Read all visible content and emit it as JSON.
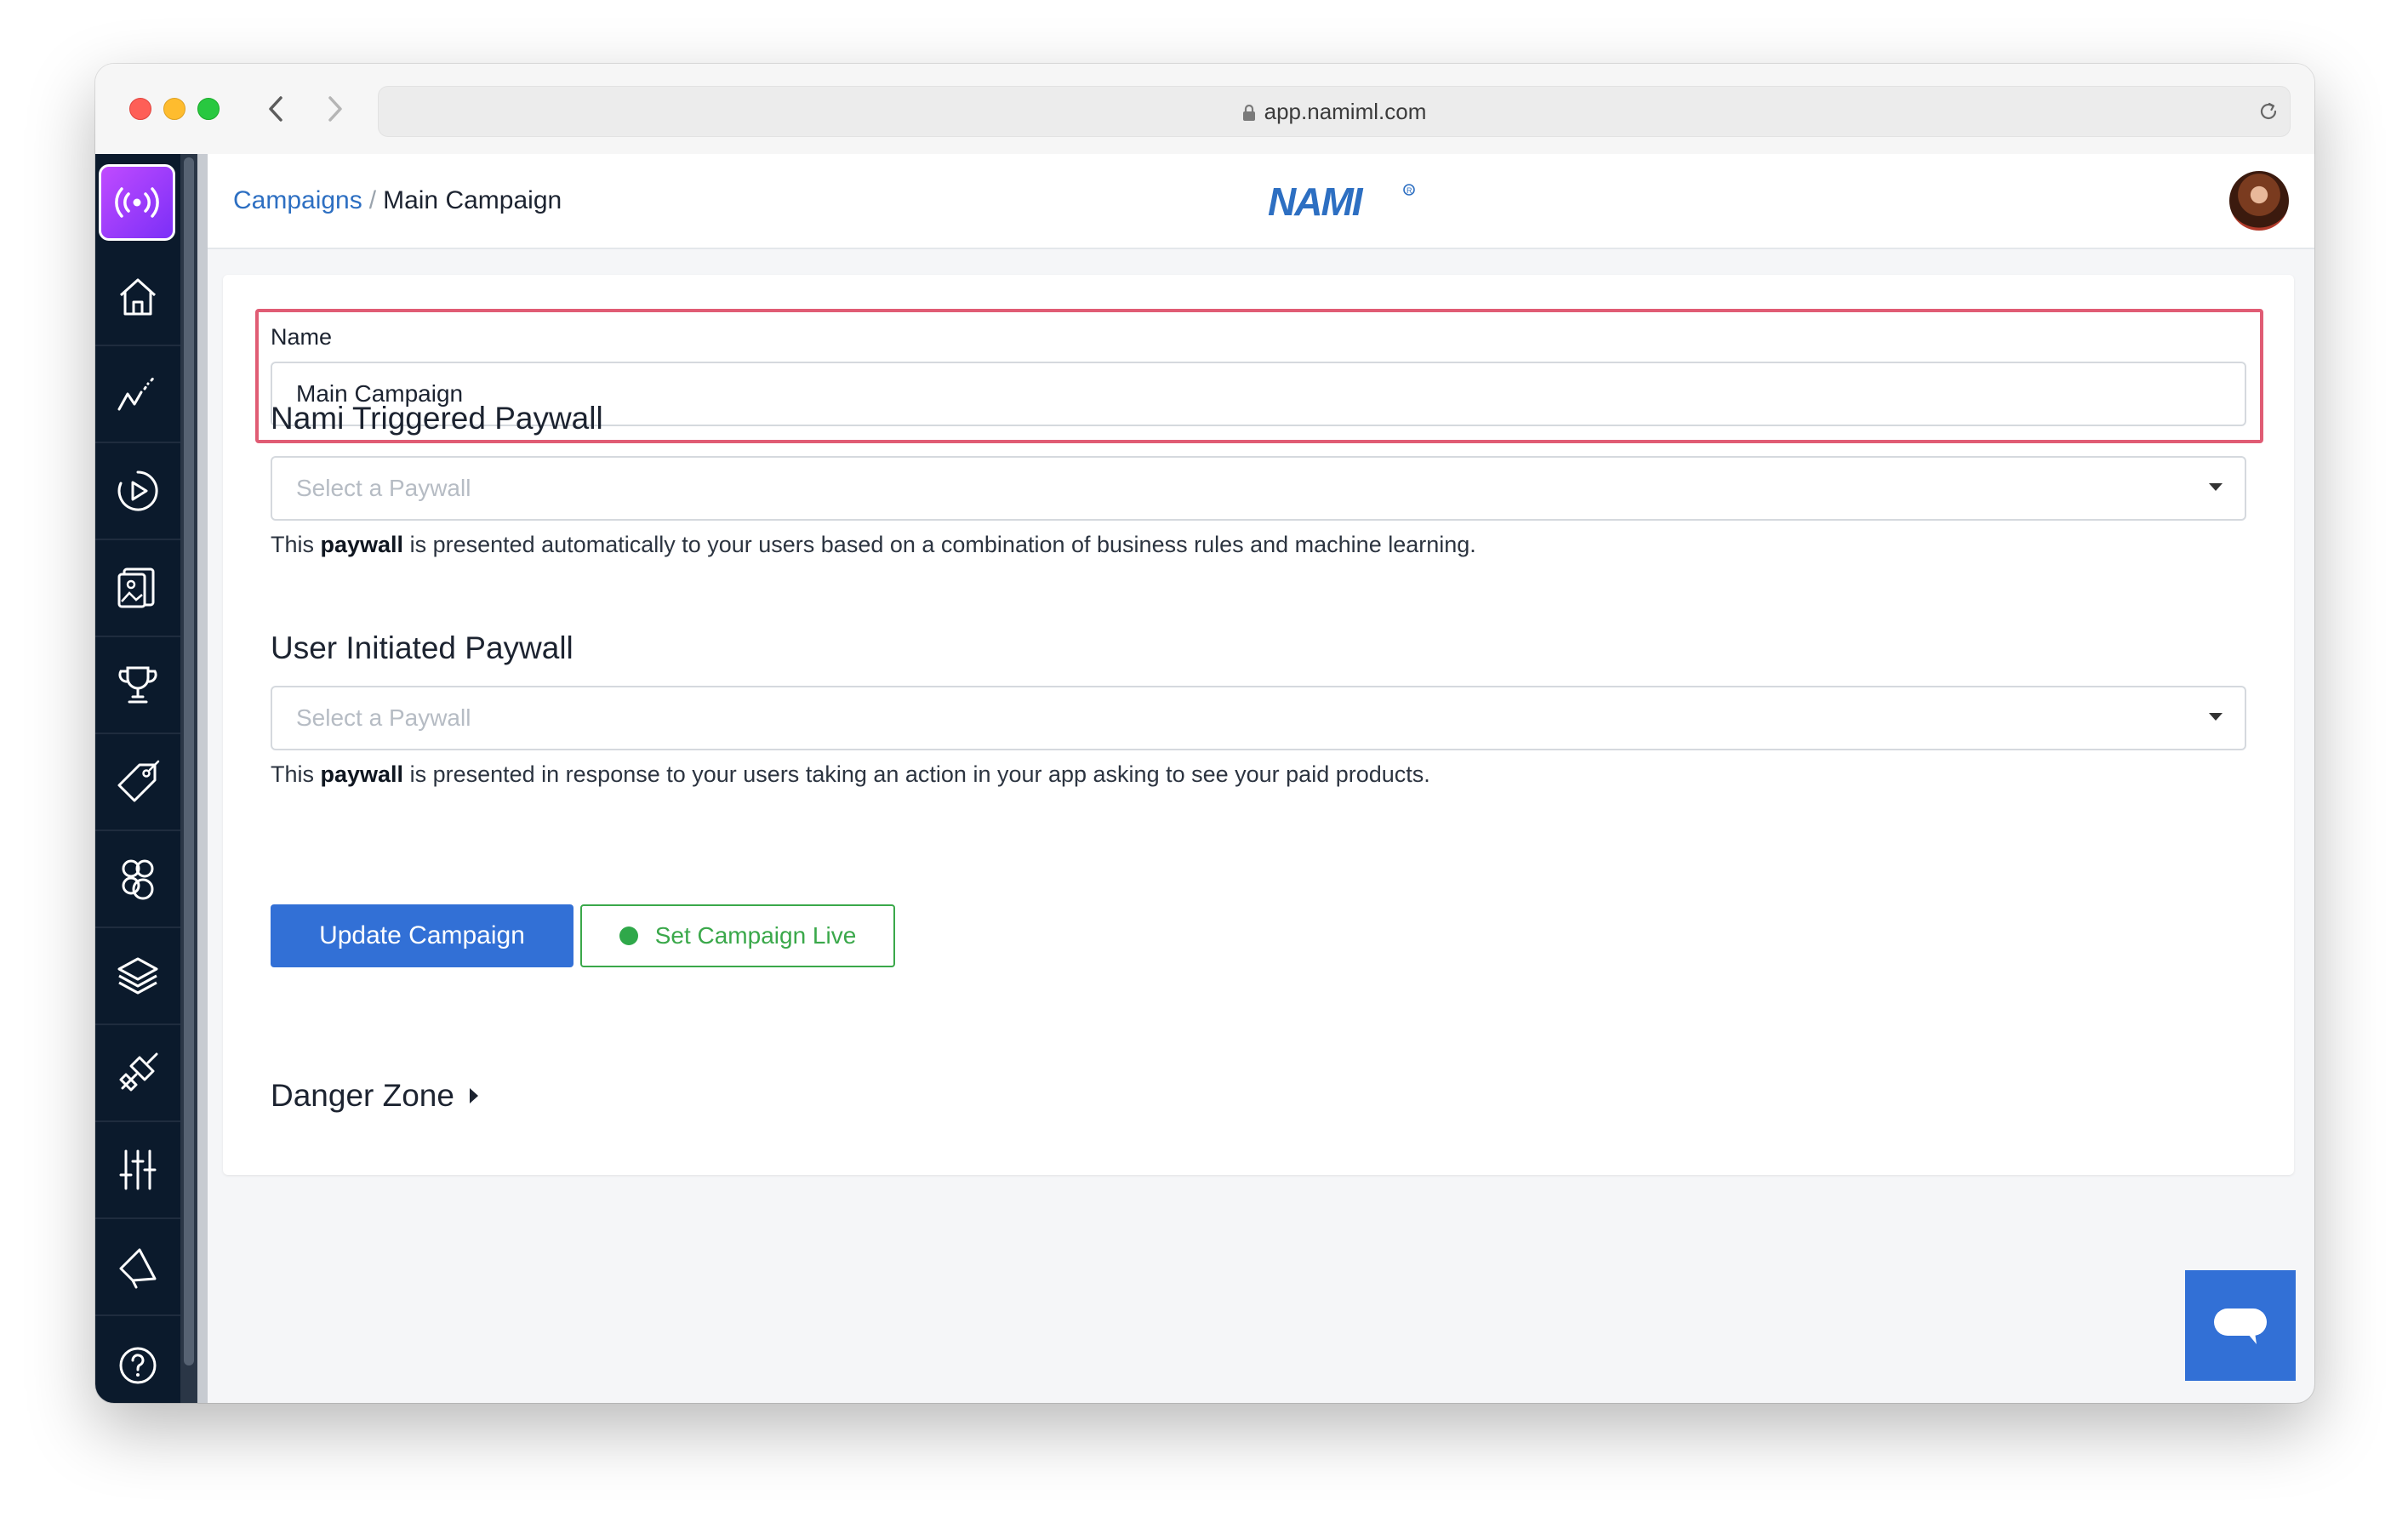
{
  "browser": {
    "url": "app.namiml.com"
  },
  "sidebar": {
    "items": [
      {
        "icon": "broadcast-icon"
      },
      {
        "icon": "home-icon"
      },
      {
        "icon": "analytics-icon"
      },
      {
        "icon": "campaign-play-icon"
      },
      {
        "icon": "paywalls-icon"
      },
      {
        "icon": "trophy-icon"
      },
      {
        "icon": "tag-icon"
      },
      {
        "icon": "users-icon"
      },
      {
        "icon": "layers-icon"
      },
      {
        "icon": "integrations-icon"
      },
      {
        "icon": "settings-sliders-icon"
      },
      {
        "icon": "megaphone-icon"
      },
      {
        "icon": "help-icon"
      }
    ]
  },
  "header": {
    "breadcrumb": {
      "parent": "Campaigns",
      "separator": "/",
      "current": "Main Campaign"
    },
    "brand": "NAMI"
  },
  "form": {
    "name_label": "Name",
    "name_value": "Main Campaign",
    "triggered": {
      "title": "Nami Triggered Paywall",
      "placeholder": "Select a Paywall",
      "help_prefix": "This ",
      "help_bold": "paywall",
      "help_suffix": " is presented automatically to your users based on a combination of business rules and machine learning."
    },
    "initiated": {
      "title": "User Initiated Paywall",
      "placeholder": "Select a Paywall",
      "help_prefix": "This ",
      "help_bold": "paywall",
      "help_suffix": " is presented in response to your users taking an action in your app asking to see your paid products."
    },
    "update_button": "Update Campaign",
    "live_button": "Set Campaign Live",
    "danger_zone": "Danger Zone"
  },
  "colors": {
    "primary": "#3270d6",
    "live_green": "#3aa84a",
    "highlight": "#e05c74",
    "sidebar_bg": "#0b1a2c"
  }
}
